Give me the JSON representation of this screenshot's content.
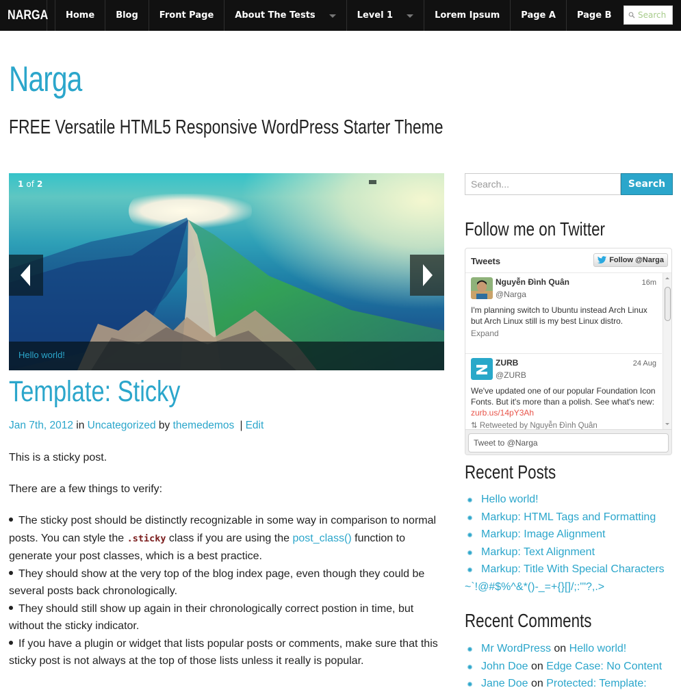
{
  "topbar": {
    "brand": "NARGA",
    "nav": [
      {
        "label": "Home",
        "dropdown": false
      },
      {
        "label": "Blog",
        "dropdown": false
      },
      {
        "label": "Front Page",
        "dropdown": false
      },
      {
        "label": "About The Tests",
        "dropdown": true
      },
      {
        "label": "Level 1",
        "dropdown": true
      },
      {
        "label": "Lorem Ipsum",
        "dropdown": false
      },
      {
        "label": "Page A",
        "dropdown": false
      },
      {
        "label": "Page B",
        "dropdown": false
      }
    ],
    "search_placeholder": "Search",
    "search_icon": "magnifier-icon"
  },
  "header": {
    "site_title": "Narga",
    "site_description": "FREE Versatile HTML5 Responsive WordPress Starter Theme"
  },
  "slider": {
    "current": "1",
    "of_label": "of",
    "total": "2",
    "caption": "Hello world!",
    "prev_icon": "arrow-left-icon",
    "next_icon": "arrow-right-icon"
  },
  "post": {
    "title": "Template: Sticky",
    "meta": {
      "date": "Jan 7th, 2012",
      "in_label": "in",
      "category": "Uncategorized",
      "by_label": "by",
      "author": "themedemos",
      "separator": "|",
      "edit_label": "Edit"
    },
    "paragraphs": [
      "This is a sticky post.",
      "There are a few things to verify:"
    ],
    "bullets": [
      {
        "before": "The sticky post should be distinctly recognizable in some way in comparison to normal posts. You can style the ",
        "code": ".sticky",
        "middle": " class if you are using the ",
        "link": "post_class()",
        "after": " func­tion to generate your post classes, which is a best practice."
      },
      {
        "text": "They should show at the very top of the blog index page, even though they could be several posts back chronologically."
      },
      {
        "text": "They should still show up again in their chronologically correct postion in time, but without the sticky indicator."
      },
      {
        "text": "If you have a plugin or widget that lists popular posts or comments, make sure that this sticky post is not always at the top of those lists unless it really is popular."
      }
    ]
  },
  "sidebar": {
    "search": {
      "placeholder": "Search...",
      "button_label": "Search"
    },
    "twitter_widget": {
      "title": "Follow me on Twitter",
      "header": "Tweets",
      "follow_label": "Follow @Narga",
      "tweets": [
        {
          "name": "Nguyễn Đình Quân",
          "handle": "@Narga",
          "time": "16m",
          "text": "I'm planning switch to Ubuntu instead Arch Linux but Arch Linux still is my best Linux distro.",
          "action": "Expand"
        },
        {
          "name": "ZURB",
          "handle": "@ZURB",
          "time": "24 Aug",
          "text": "We've updated one of our popular Foundation Icon Fonts. But it's more than a polish. See what's new: ",
          "link": "zurb.us/14pY3Ah",
          "retweet": "Retweeted by Nguyễn Đình Quân"
        }
      ],
      "compose_placeholder": "Tweet to @Narga"
    },
    "recent_posts": {
      "title": "Recent Posts",
      "items": [
        "Hello world!",
        "Markup: HTML Tags and Formatting",
        "Markup: Image Alignment",
        "Markup: Text Alignment",
        "Markup: Title With Special Characters ~`!@#$%^&*()-_=+{}[]/;:'\"?,.>"
      ]
    },
    "recent_comments": {
      "title": "Recent Comments",
      "on_label": "on",
      "items": [
        {
          "author": "Mr WordPress",
          "author_linked": true,
          "post": "Hello world!"
        },
        {
          "author": "John Doe",
          "author_linked": false,
          "post": "Edge Case: No Content"
        },
        {
          "author": "Jane Doe",
          "author_linked": false,
          "post": "Protected: Template:"
        }
      ]
    }
  },
  "colors": {
    "accent": "#2ba6cb",
    "topbar_bg": "#111111",
    "text": "#222222",
    "code": "#7a1c1c",
    "tweet_link": "#e8544a"
  }
}
